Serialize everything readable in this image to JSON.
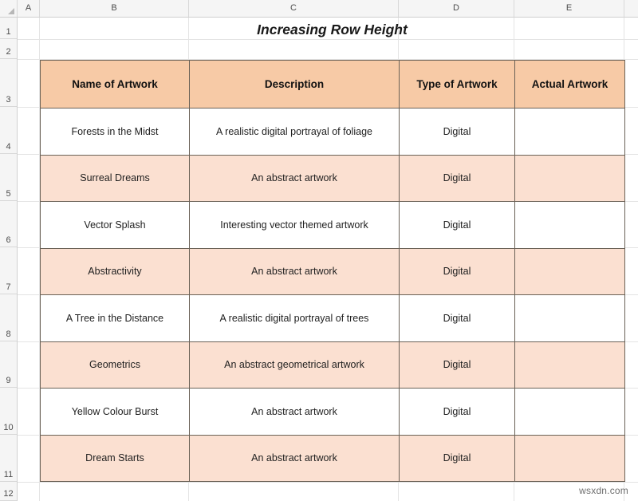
{
  "spreadsheet": {
    "title": "Increasing Row Height",
    "watermark": "wsxdn.com",
    "column_headers": [
      "A",
      "B",
      "C",
      "D",
      "E"
    ],
    "row_headers": [
      "1",
      "2",
      "3",
      "4",
      "5",
      "6",
      "7",
      "8",
      "9",
      "10",
      "11",
      "12"
    ],
    "colors": {
      "header_fill": "#f7caa6",
      "band_fill": "#fbe0d1",
      "plain_fill": "#ffffff",
      "border": "#6b6257",
      "grid": "#e4e4e4",
      "header_strip": "#f5f5f5"
    }
  },
  "table": {
    "columns": [
      "Name of Artwork",
      "Description",
      "Type of Artwork",
      "Actual Artwork"
    ],
    "rows": [
      {
        "name": "Forests in the Midst",
        "description": "A realistic digital portrayal of  foliage",
        "type": "Digital",
        "artwork": "",
        "banded": false
      },
      {
        "name": "Surreal Dreams",
        "description": "An abstract artwork",
        "type": "Digital",
        "artwork": "",
        "banded": true
      },
      {
        "name": "Vector Splash",
        "description": "Interesting vector themed artwork",
        "type": "Digital",
        "artwork": "",
        "banded": false
      },
      {
        "name": "Abstractivity",
        "description": "An abstract artwork",
        "type": "Digital",
        "artwork": "",
        "banded": true
      },
      {
        "name": "A Tree in the Distance",
        "description": "A realistic digital portrayal of trees",
        "type": "Digital",
        "artwork": "",
        "banded": false
      },
      {
        "name": "Geometrics",
        "description": "An abstract geometrical artwork",
        "type": "Digital",
        "artwork": "",
        "banded": true
      },
      {
        "name": "Yellow Colour Burst",
        "description": "An abstract artwork",
        "type": "Digital",
        "artwork": "",
        "banded": false
      },
      {
        "name": "Dream Starts",
        "description": "An abstract artwork",
        "type": "Digital",
        "artwork": "",
        "banded": true
      }
    ]
  }
}
